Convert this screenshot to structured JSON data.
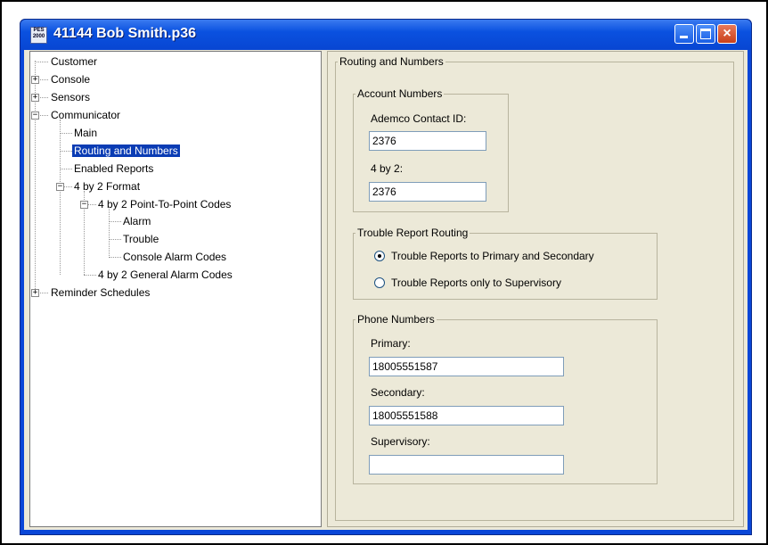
{
  "window": {
    "title": "41144 Bob Smith.p36",
    "app_icon_text": "PES\n2000",
    "buttons": {
      "minimize": "minimize",
      "maximize": "maximize",
      "close": "×"
    }
  },
  "tree": {
    "items": [
      {
        "label": "Customer",
        "expander": ""
      },
      {
        "label": "Console",
        "expander": "+"
      },
      {
        "label": "Sensors",
        "expander": "+"
      },
      {
        "label": "Communicator",
        "expander": "−"
      },
      {
        "label": "Main",
        "expander": ""
      },
      {
        "label": "Routing and Numbers",
        "expander": "",
        "selected": true
      },
      {
        "label": "Enabled Reports",
        "expander": ""
      },
      {
        "label": "4 by 2 Format",
        "expander": "−"
      },
      {
        "label": "4 by 2 Point-To-Point Codes",
        "expander": "−"
      },
      {
        "label": "Alarm",
        "expander": ""
      },
      {
        "label": "Trouble",
        "expander": ""
      },
      {
        "label": "Console Alarm Codes",
        "expander": ""
      },
      {
        "label": "4 by 2 General Alarm Codes",
        "expander": ""
      },
      {
        "label": "Reminder Schedules",
        "expander": "+"
      }
    ]
  },
  "panel": {
    "title": "Routing and Numbers",
    "account_numbers": {
      "title": "Account Numbers",
      "contact_id_label": "Ademco Contact ID:",
      "contact_id_value": "2376",
      "four_by_two_label": "4 by 2:",
      "four_by_two_value": "2376"
    },
    "trouble_routing": {
      "title": "Trouble Report Routing",
      "option_primary": "Trouble Reports to Primary and Secondary",
      "option_supervisory": "Trouble Reports only to Supervisory",
      "selected": "primary_secondary"
    },
    "phone_numbers": {
      "title": "Phone Numbers",
      "primary_label": "Primary:",
      "primary_value": "18005551587",
      "secondary_label": "Secondary:",
      "secondary_value": "18005551588",
      "supervisory_label": "Supervisory:",
      "supervisory_value": ""
    }
  }
}
